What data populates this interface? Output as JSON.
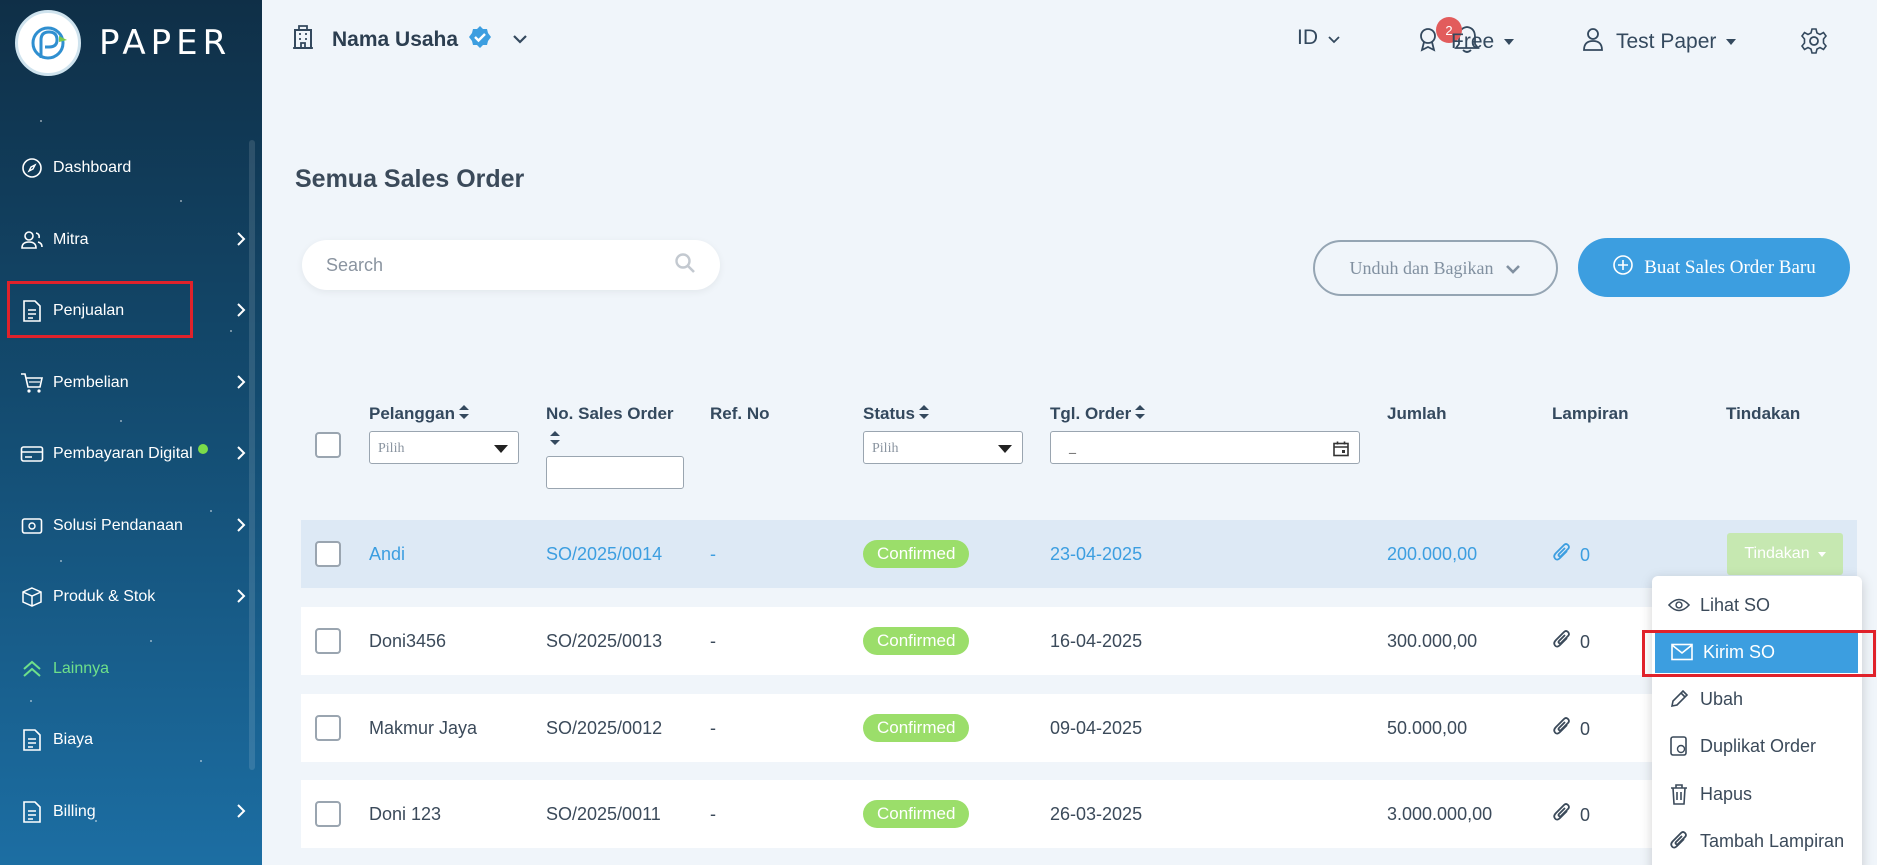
{
  "app": {
    "logo_text": "PAPER"
  },
  "sidebar": {
    "items": [
      {
        "label": "Dashboard",
        "icon": "compass-icon"
      },
      {
        "label": "Mitra",
        "icon": "users-icon"
      },
      {
        "label": "Penjualan",
        "icon": "document-icon"
      },
      {
        "label": "Pembelian",
        "icon": "cart-icon"
      },
      {
        "label": "Pembayaran Digital",
        "icon": "card-icon"
      },
      {
        "label": "Solusi Pendanaan",
        "icon": "wallet-icon"
      },
      {
        "label": "Produk & Stok",
        "icon": "box-icon"
      },
      {
        "label": "Lainnya",
        "icon": "chevrons-up-icon"
      },
      {
        "label": "Biaya",
        "icon": "document-icon"
      },
      {
        "label": "Billing",
        "icon": "document-icon"
      }
    ]
  },
  "header": {
    "business_name": "Nama Usaha",
    "notification_count": "2",
    "language": "ID",
    "plan": "Free",
    "user_name": "Test Paper"
  },
  "main": {
    "title": "Semua Sales Order",
    "search_placeholder": "Search",
    "download_share_label": "Unduh dan Bagikan",
    "create_button_label": "Buat Sales Order Baru"
  },
  "table": {
    "columns": {
      "customer": "Pelanggan",
      "so_number": "No. Sales Order",
      "ref_no": "Ref. No",
      "status": "Status",
      "order_date": "Tgl. Order",
      "amount": "Jumlah",
      "attachment": "Lampiran",
      "action": "Tindakan"
    },
    "filters": {
      "customer_placeholder": "Pilih",
      "status_placeholder": "Pilih",
      "date_placeholder": "_"
    },
    "rows": [
      {
        "customer": "Andi",
        "so": "SO/2025/0014",
        "ref": "-",
        "status": "Confirmed",
        "date": "23-04-2025",
        "amount": "200.000,00",
        "attachments": "0",
        "action": "Tindakan"
      },
      {
        "customer": "Doni3456",
        "so": "SO/2025/0013",
        "ref": "-",
        "status": "Confirmed",
        "date": "16-04-2025",
        "amount": "300.000,00",
        "attachments": "0"
      },
      {
        "customer": "Makmur Jaya",
        "so": "SO/2025/0012",
        "ref": "-",
        "status": "Confirmed",
        "date": "09-04-2025",
        "amount": "50.000,00",
        "attachments": "0"
      },
      {
        "customer": "Doni 123",
        "so": "SO/2025/0011",
        "ref": "-",
        "status": "Confirmed",
        "date": "26-03-2025",
        "amount": "3.000.000,00",
        "attachments": "0"
      }
    ]
  },
  "action_menu": {
    "items": [
      {
        "label": "Lihat SO",
        "icon": "eye-icon"
      },
      {
        "label": "Kirim SO",
        "icon": "mail-icon"
      },
      {
        "label": "Ubah",
        "icon": "pencil-icon"
      },
      {
        "label": "Duplikat Order",
        "icon": "duplicate-icon"
      },
      {
        "label": "Hapus",
        "icon": "trash-icon"
      },
      {
        "label": "Tambah Lampiran",
        "icon": "paperclip-icon"
      }
    ]
  },
  "colors": {
    "accent": "#3c9ee0",
    "status_confirmed": "#9bde6a",
    "highlight": "#e0222b",
    "sidebar_dark": "#0f2f47"
  }
}
